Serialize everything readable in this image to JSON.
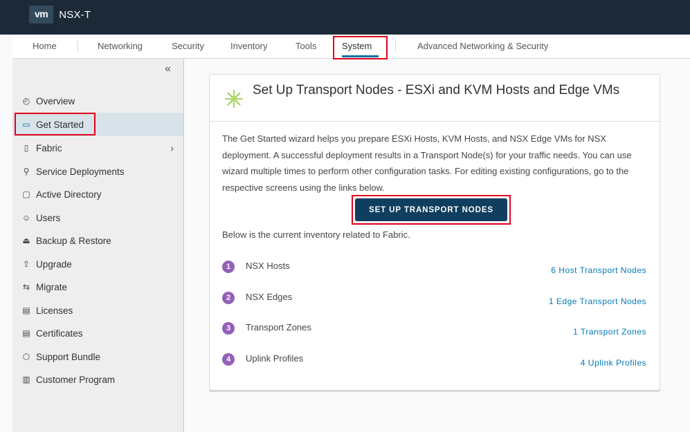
{
  "header": {
    "logo_text": "vm",
    "app_title": "NSX-T"
  },
  "nav": {
    "tabs": [
      {
        "label": "Home"
      },
      {
        "label": "Networking"
      },
      {
        "label": "Security"
      },
      {
        "label": "Inventory"
      },
      {
        "label": "Tools"
      },
      {
        "label": "System"
      },
      {
        "label": "Advanced Networking & Security"
      }
    ],
    "active": "System"
  },
  "sidebar": {
    "collapse_glyph": "«",
    "items": [
      {
        "label": "Overview",
        "icon": "gauge-icon"
      },
      {
        "label": "Get Started",
        "icon": "laptop-icon"
      },
      {
        "label": "Fabric",
        "icon": "server-icon"
      },
      {
        "label": "Service Deployments",
        "icon": "deploy-icon"
      },
      {
        "label": "Active Directory",
        "icon": "folder-icon"
      },
      {
        "label": "Users",
        "icon": "users-icon"
      },
      {
        "label": "Backup & Restore",
        "icon": "backup-icon"
      },
      {
        "label": "Upgrade",
        "icon": "upgrade-icon"
      },
      {
        "label": "Migrate",
        "icon": "migrate-icon"
      },
      {
        "label": "Licenses",
        "icon": "license-icon"
      },
      {
        "label": "Certificates",
        "icon": "certificate-icon"
      },
      {
        "label": "Support Bundle",
        "icon": "bundle-icon"
      },
      {
        "label": "Customer Program",
        "icon": "document-icon"
      }
    ],
    "active": "Get Started"
  },
  "card": {
    "title": "Set Up Transport Nodes - ESXi and KVM Hosts and Edge VMs",
    "description": "The Get Started wizard helps you prepare ESXi Hosts, KVM Hosts, and NSX Edge VMs for NSX deployment. A successful deployment results in a Transport Node(s) for your traffic needs. You can use wizard multiple times to perform other configuration tasks. For editing existing configurations, go to the respective screens using the links below.",
    "button_label": "SET UP TRANSPORT NODES",
    "inventory_intro": "Below is the current inventory related to Fabric.",
    "inventory": [
      {
        "num": "1",
        "label": "NSX Hosts",
        "link": "6 Host Transport Nodes"
      },
      {
        "num": "2",
        "label": "NSX Edges",
        "link": "1 Edge Transport Nodes"
      },
      {
        "num": "3",
        "label": "Transport Zones",
        "link": "1 Transport Zones"
      },
      {
        "num": "4",
        "label": "Uplink Profiles",
        "link": "4 Uplink Profiles"
      }
    ]
  },
  "colors": {
    "header_bg": "#1c2a38",
    "accent_blue": "#0072a3",
    "button_bg": "#0f3e5e",
    "highlight_red": "#e0001b",
    "step_purple": "#9460b8",
    "link_blue": "#0079b8",
    "icon_green": "#8cc63f"
  }
}
